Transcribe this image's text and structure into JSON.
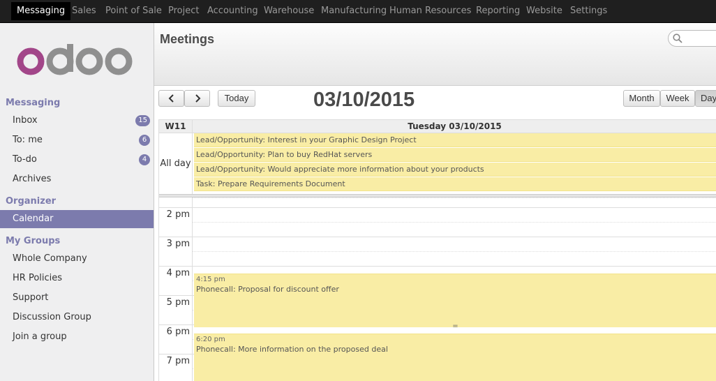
{
  "topbar": {
    "items": [
      {
        "label": "Messaging",
        "active": true
      },
      {
        "label": "Sales"
      },
      {
        "label": "Point of Sale"
      },
      {
        "label": "Project"
      },
      {
        "label": "Accounting"
      },
      {
        "label": "Warehouse"
      },
      {
        "label": "Manufacturing"
      },
      {
        "label": "Human Resources"
      },
      {
        "label": "Reporting"
      },
      {
        "label": "Website"
      },
      {
        "label": "Settings"
      }
    ]
  },
  "sidebar": {
    "logo": "odoo",
    "messaging_title": "Messaging",
    "messaging_items": [
      {
        "label": "Inbox",
        "badge": "15"
      },
      {
        "label": "To: me",
        "badge": "6"
      },
      {
        "label": "To-do",
        "badge": "4"
      },
      {
        "label": "Archives"
      }
    ],
    "organizer_title": "Organizer",
    "organizer_items": [
      {
        "label": "Calendar",
        "active": true
      }
    ],
    "groups_title": "My Groups",
    "groups_items": [
      {
        "label": "Whole Company"
      },
      {
        "label": "HR Policies"
      },
      {
        "label": "Support"
      },
      {
        "label": "Discussion Group"
      },
      {
        "label": "Join a group"
      }
    ]
  },
  "header": {
    "title": "Meetings",
    "search_icon": "search-icon"
  },
  "toolbar": {
    "prev_icon": "chevron-left-icon",
    "next_icon": "chevron-right-icon",
    "today_label": "Today",
    "date": "03/10/2015",
    "views": [
      {
        "label": "Month"
      },
      {
        "label": "Week"
      },
      {
        "label": "Day",
        "active": true
      }
    ]
  },
  "calendar": {
    "week_label": "W11",
    "day_label": "Tuesday 03/10/2015",
    "allday_label": "All day",
    "allday_events": [
      "Lead/Opportunity: Interest in your Graphic Design Project",
      "Lead/Opportunity: Plan to buy RedHat servers",
      "Lead/Opportunity: Would appreciate more information about your products",
      "Task: Prepare Requirements Document"
    ],
    "hours": [
      "2 pm",
      "3 pm",
      "4 pm",
      "5 pm",
      "6 pm",
      "7 pm"
    ],
    "events": [
      {
        "time": "4:15 pm",
        "title": "Phonecall: Proposal for discount offer",
        "grip": "="
      },
      {
        "time": "6:20 pm",
        "title": "Phonecall: More information on the proposed deal"
      }
    ],
    "colors": {
      "event": "#f9eda5",
      "accent": "#7c7bad"
    }
  }
}
